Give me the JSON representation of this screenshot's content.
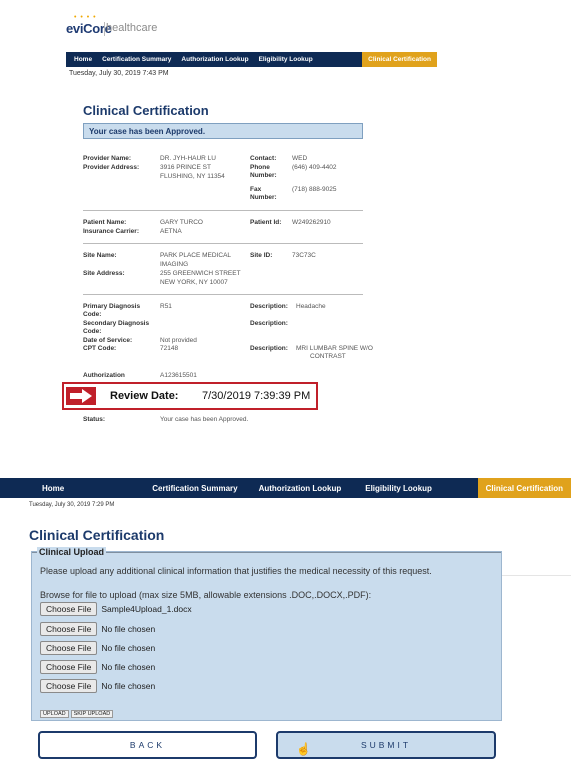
{
  "logo": {
    "brand": "eviCore",
    "suffix": "healthcare"
  },
  "top_screen": {
    "nav": {
      "items": [
        "Home",
        "Certification Summary",
        "Authorization Lookup",
        "Eligibility Lookup"
      ],
      "active": "Clinical Certification"
    },
    "date": "Tuesday, July 30, 2019 7:43 PM",
    "title": "Clinical Certification",
    "status_banner": "Your case has been Approved.",
    "provider": {
      "name_label": "Provider Name:",
      "name": "DR. JYH-HAUR LU",
      "address_label": "Provider Address:",
      "address1": "3916 PRINCE ST",
      "address2": "FLUSHING, NY 11354",
      "contact_label": "Contact:",
      "contact": "WED",
      "phone_label1": "Phone",
      "phone_label2": "Number:",
      "phone": "(646) 409-4402",
      "fax_label1": "Fax",
      "fax_label2": "Number:",
      "fax": "(718) 888-9025"
    },
    "patient": {
      "name_label": "Patient Name:",
      "name": "GARY TURCO",
      "carrier_label": "Insurance Carrier:",
      "carrier": "AETNA",
      "id_label": "Patient Id:",
      "id": "W249262910"
    },
    "site": {
      "name_label": "Site Name:",
      "name1": "PARK PLACE MEDICAL",
      "name2": "IMAGING",
      "address_label": "Site Address:",
      "address1": "255 GREENWICH STREET",
      "address2": "NEW YORK, NY 10007",
      "id_label": "Site ID:",
      "id": "73C73C"
    },
    "diagnosis": {
      "primary_label1": "Primary Diagnosis",
      "primary_label2": "Code:",
      "primary": "R51",
      "desc_label": "Description:",
      "primary_desc": "Headache",
      "secondary_label1": "Secondary Diagnosis",
      "secondary_label2": "Code:",
      "desc2_label": "Description:",
      "dos_label": "Date of Service:",
      "dos": "Not provided",
      "cpt_label": "CPT Code:",
      "cpt": "72148",
      "desc3_label": "Description:",
      "cpt_desc1": "MRI LUMBAR SPINE W/O",
      "cpt_desc2": "CONTRAST",
      "auth_label": "Authorization",
      "auth": "A123615501",
      "status_label": "Status:",
      "status": "Your case has been Approved."
    },
    "review": {
      "label": "Review Date:",
      "value": "7/30/2019 7:39:39 PM"
    }
  },
  "bottom_screen": {
    "nav": {
      "items": [
        "Home",
        "Certification Summary",
        "Authorization Lookup",
        "Eligibility Lookup"
      ],
      "active": "Clinical Certification"
    },
    "date": "Tuesday, July 30, 2019 7:29 PM",
    "title": "Clinical Certification",
    "upload": {
      "legend": "Clinical Upload",
      "instruction": "Please upload any additional clinical information that justifies the medical necessity of this request.",
      "browse_text": "Browse for file to upload (max size 5MB, allowable extensions .DOC,.DOCX,.PDF):",
      "choose_label": "Choose File",
      "files": [
        "Sample4Upload_1.docx",
        "No file chosen",
        "No file chosen",
        "No file chosen",
        "No file chosen"
      ],
      "upload_btn": "UPLOAD",
      "skip_btn": "SKIP UPLOAD"
    },
    "back_btn": "BACK",
    "submit_btn": "SUBMIT"
  },
  "colors": {
    "navy": "#0e2a54",
    "gold": "#e0a21c",
    "panel": "#c9dced",
    "callout_red": "#c0202a"
  }
}
